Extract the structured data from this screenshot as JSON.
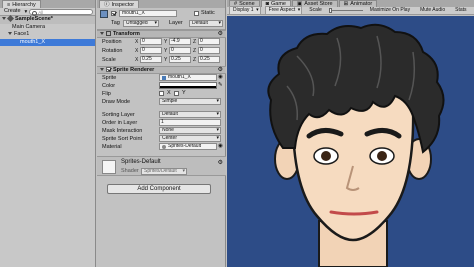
{
  "hierarchy": {
    "tab_label": "Hierarchy",
    "create_label": "Create",
    "search_placeholder": "All",
    "scene_name": "SampleScene*",
    "items": [
      {
        "label": "Main Camera"
      },
      {
        "label": "Face1"
      },
      {
        "label": "mouth1_X"
      }
    ]
  },
  "inspector": {
    "tab_label": "Inspector",
    "object_name": "mouth1_X",
    "static_label": "Static",
    "tag_label": "Tag",
    "tag_value": "Untagged",
    "layer_label": "Layer",
    "layer_value": "Default",
    "transform": {
      "title": "Transform",
      "position_label": "Position",
      "rotation_label": "Rotation",
      "scale_label": "Scale",
      "position": {
        "x": "0",
        "y": "-4.9",
        "z": "0"
      },
      "rotation": {
        "x": "0",
        "y": "0",
        "z": "0"
      },
      "scale": {
        "x": "0.25",
        "y": "0.25",
        "z": "0.25"
      }
    },
    "sprite_renderer": {
      "title": "Sprite Renderer",
      "sprite_label": "Sprite",
      "sprite_value": "mouth1_X",
      "color_label": "Color",
      "flip_label": "Flip",
      "flip_x": "X",
      "flip_y": "Y",
      "draw_mode_label": "Draw Mode",
      "draw_mode_value": "Simple",
      "sorting_layer_label": "Sorting Layer",
      "sorting_layer_value": "Default",
      "order_label": "Order in Layer",
      "order_value": "1",
      "mask_label": "Mask Interaction",
      "mask_value": "None",
      "sort_point_label": "Sprite Sort Point",
      "sort_point_value": "Center",
      "material_label": "Material",
      "material_value": "Sprites-Default"
    },
    "material_box": {
      "name": "Sprites-Default",
      "shader_label": "Shader",
      "shader_value": "Sprites/Default"
    },
    "add_component_label": "Add Component"
  },
  "view": {
    "tabs": [
      {
        "label": "Scene"
      },
      {
        "label": "Game"
      },
      {
        "label": "Asset Store"
      },
      {
        "label": "Animator"
      }
    ],
    "display_value": "Display 1",
    "aspect_value": "Free Aspect",
    "scale_label": "Scale",
    "maximize_label": "Maximize On Play",
    "mute_label": "Mute Audio",
    "stats_label": "Stats",
    "background_color": "#2d4c87"
  }
}
